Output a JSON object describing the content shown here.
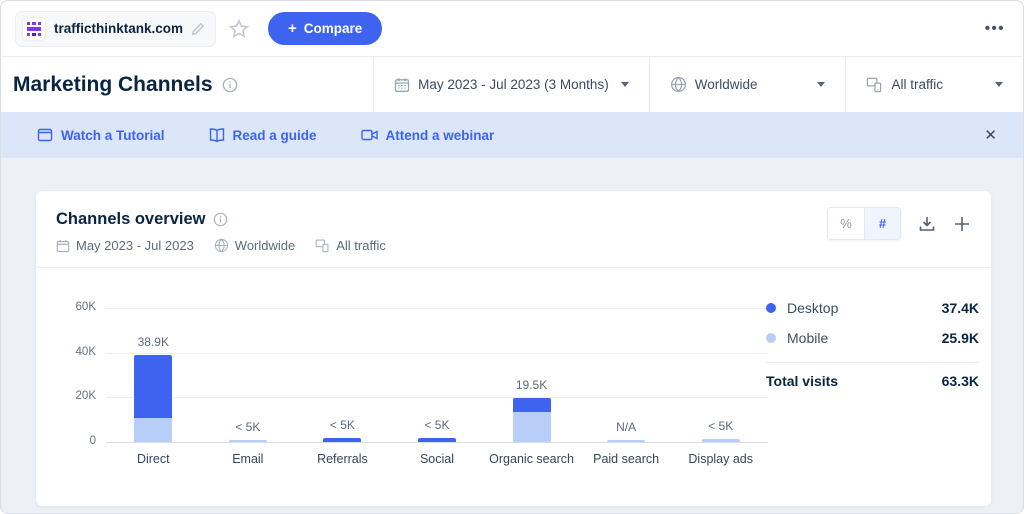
{
  "topbar": {
    "domain": "trafficthinktank.com",
    "compare_plus": "+",
    "compare_label": "Compare",
    "menu_glyph": "•••"
  },
  "header": {
    "title": "Marketing Channels",
    "filters": {
      "date_range": "May 2023 - Jul 2023 (3 Months)",
      "region": "Worldwide",
      "traffic": "All traffic"
    }
  },
  "banner": {
    "links": [
      {
        "label": "Watch a Tutorial"
      },
      {
        "label": "Read a guide"
      },
      {
        "label": "Attend a webinar"
      }
    ],
    "close_glyph": "✕"
  },
  "card": {
    "title": "Channels overview",
    "subtitle": {
      "date_range": "May 2023 - Jul 2023",
      "region": "Worldwide",
      "traffic": "All traffic"
    },
    "controls": {
      "percent_label": "%",
      "number_label": "#"
    }
  },
  "legend": {
    "items": [
      {
        "name": "Desktop",
        "value": "37.4K",
        "color": "#3e63f1"
      },
      {
        "name": "Mobile",
        "value": "25.9K",
        "color": "#b9cdf9"
      }
    ],
    "total_label": "Total visits",
    "total_value": "63.3K"
  },
  "chart_data": {
    "type": "bar",
    "stacked": true,
    "title": "Channels overview",
    "categories": [
      "Direct",
      "Email",
      "Referrals",
      "Social",
      "Organic search",
      "Paid search",
      "Display ads"
    ],
    "series": [
      {
        "name": "Desktop",
        "color": "#3e63f1",
        "values": [
          28100,
          0,
          1900,
          1900,
          6200,
          0,
          0
        ]
      },
      {
        "name": "Mobile",
        "color": "#b9cdf9",
        "values": [
          10800,
          900,
          0,
          0,
          13300,
          1100,
          1300
        ]
      }
    ],
    "bar_labels": [
      "38.9K",
      "< 5K",
      "< 5K",
      "< 5K",
      "19.5K",
      "N/A",
      "< 5K"
    ],
    "totals_displayed": {
      "Desktop": "37.4K",
      "Mobile": "25.9K",
      "Total visits": "63.3K"
    },
    "yticks": [
      "60K",
      "40K",
      "20K",
      "0"
    ],
    "ylim": [
      0,
      60000
    ],
    "grid": true,
    "legend_position": "right"
  }
}
